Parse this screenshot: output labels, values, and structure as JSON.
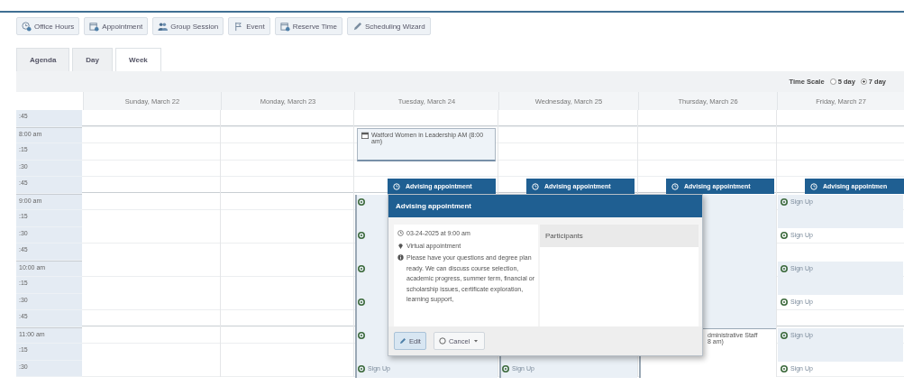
{
  "toolbar": [
    {
      "label": "Office Hours"
    },
    {
      "label": "Appointment"
    },
    {
      "label": "Group Session"
    },
    {
      "label": "Event"
    },
    {
      "label": "Reserve Time"
    },
    {
      "label": "Scheduling Wizard"
    }
  ],
  "tabs": [
    {
      "label": "Agenda",
      "selected": false
    },
    {
      "label": "Day",
      "selected": false
    },
    {
      "label": "Week",
      "selected": true
    }
  ],
  "time_scale": {
    "label": "Time Scale",
    "options": [
      {
        "label": "5 day",
        "selected": false
      },
      {
        "label": "7 day",
        "selected": true
      }
    ]
  },
  "times": [
    ":45",
    "8:00 am",
    ":15",
    ":30",
    ":45",
    "9:00 am",
    ":15",
    ":30",
    ":45",
    "10:00 am",
    ":15",
    ":30",
    ":45",
    "11:00 am",
    ":15",
    ":30"
  ],
  "days": [
    {
      "label": "Sunday, March 22"
    },
    {
      "label": "Monday, March 23"
    },
    {
      "label": "Tuesday, March 24",
      "entries": [
        {
          "kind": "event",
          "title": "Watford Women in Leadership AM (8:00 am)"
        },
        {
          "kind": "tab",
          "label": "Advising appointment"
        },
        {
          "kind": "block"
        },
        {
          "kind": "signup"
        },
        {
          "kind": "signup"
        },
        {
          "kind": "signup"
        },
        {
          "kind": "signup"
        },
        {
          "kind": "signup"
        },
        {
          "kind": "signup",
          "label": "Sign Up"
        }
      ]
    },
    {
      "label": "Wednesday, March 25",
      "entries": [
        {
          "kind": "tab",
          "label": "Advising appointment"
        },
        {
          "kind": "block"
        },
        {
          "kind": "signup",
          "label": "Sign Up"
        }
      ]
    },
    {
      "label": "Thursday, March 26",
      "entries": [
        {
          "kind": "tab",
          "label": "Advising appointment"
        },
        {
          "kind": "block"
        },
        {
          "kind": "event",
          "title": "dministrative Staff",
          "time": "8 am)"
        }
      ]
    },
    {
      "label": "Friday, March 27",
      "entries": [
        {
          "kind": "tab",
          "label": "Advising appointmen"
        },
        {
          "kind": "signup",
          "label": "Sign Up"
        },
        {
          "kind": "signup",
          "label": "Sign Up"
        },
        {
          "kind": "signup",
          "label": "Sign Up"
        },
        {
          "kind": "signup",
          "label": "Sign Up"
        },
        {
          "kind": "signup",
          "label": "Sign Up"
        },
        {
          "kind": "signup",
          "label": "Sign Up"
        }
      ]
    }
  ],
  "popover": {
    "title": "Advising appointment",
    "details": [
      {
        "kind": "time",
        "text": "03-24-2025 at 9:00 am"
      },
      {
        "kind": "location",
        "text": "Virtual appointment"
      },
      {
        "kind": "description",
        "text": "Please have your questions and degree plan ready. We can discuss course selection, academic progress, summer term, financial or scholarship issues, certificate exploration, learning support,"
      }
    ],
    "participants": "Participants",
    "buttons": [
      {
        "kind": "edit",
        "label": "Edit"
      },
      {
        "kind": "cancel",
        "label": "Cancel"
      }
    ]
  }
}
